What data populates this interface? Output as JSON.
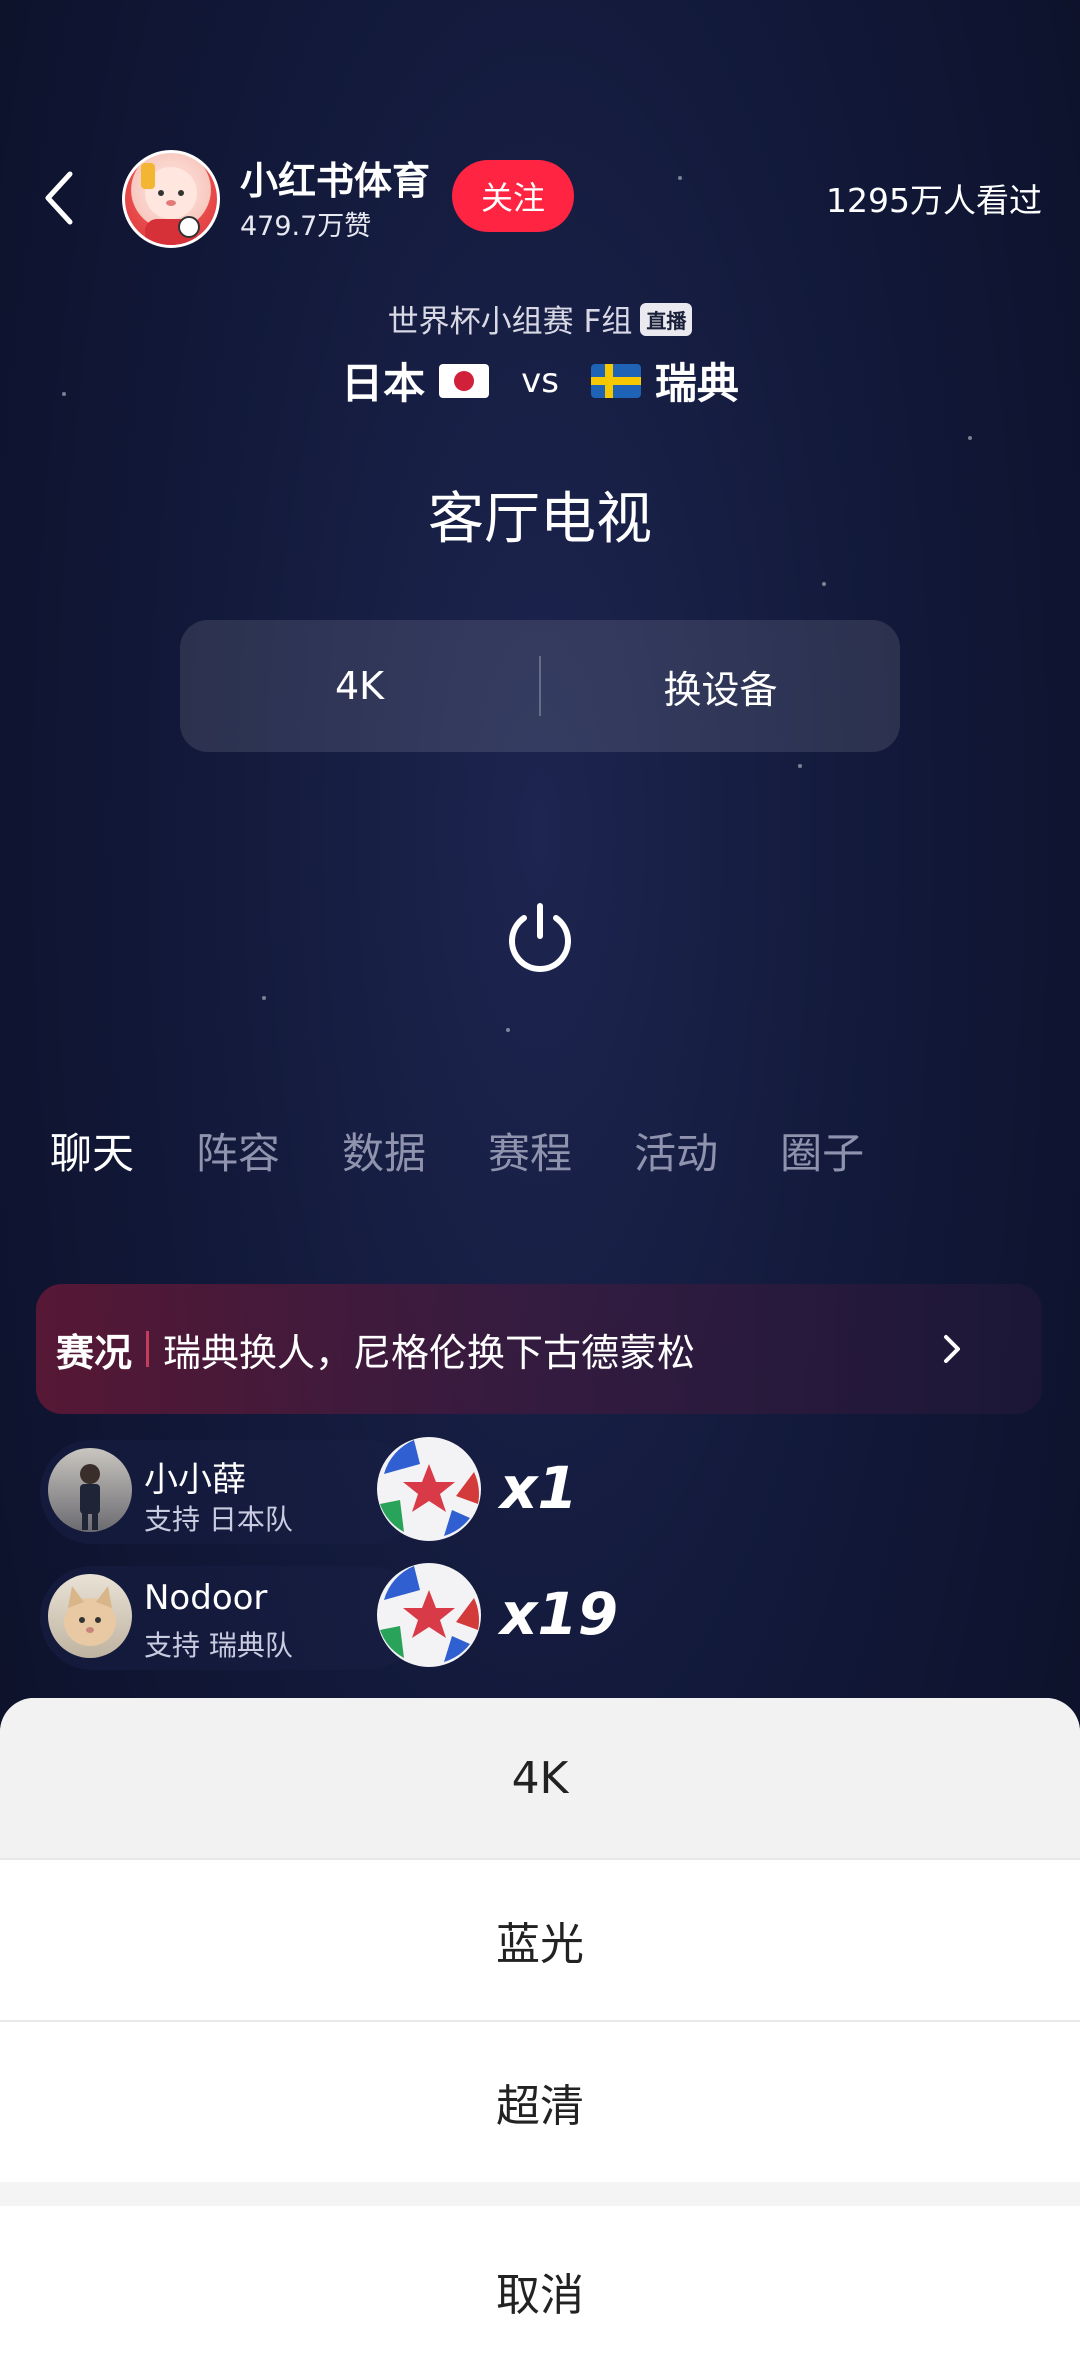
{
  "header": {
    "account_name": "小红书体育",
    "likes": "479.7万赞",
    "follow_label": "关注",
    "viewers": "1295万人看过"
  },
  "match": {
    "subtitle": "世界杯小组赛 F组",
    "live_badge": "直播",
    "team_home": "日本",
    "vs": "vs",
    "team_away": "瑞典"
  },
  "device": {
    "name": "客厅电视",
    "quality_label": "4K",
    "switch_label": "换设备"
  },
  "tabs": [
    "聊天",
    "阵容",
    "数据",
    "赛程",
    "活动",
    "圈子"
  ],
  "news": {
    "tag": "赛况",
    "text": "瑞典换人，尼格伦换下古德蒙松"
  },
  "gifts": [
    {
      "name": "小小薛",
      "support": "支持 日本队",
      "count": "x1"
    },
    {
      "name": "Nodoor",
      "support": "支持 瑞典队",
      "count": "x19"
    }
  ],
  "sheet": {
    "options": [
      "4K",
      "蓝光",
      "超清"
    ],
    "cancel_label": "取消"
  }
}
